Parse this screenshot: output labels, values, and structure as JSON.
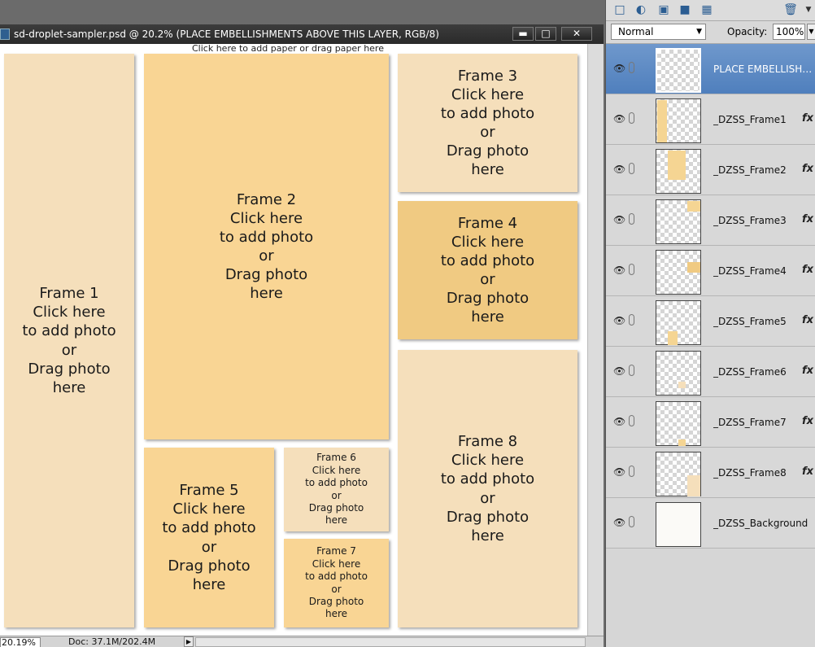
{
  "document": {
    "title": "sd-droplet-sampler.psd @ 20.2% (PLACE EMBELLISHMENTS ABOVE THIS LAYER, RGB/8)",
    "paper_hint": "Click here to add paper or drag paper here",
    "window_buttons": {
      "minimize": "▬",
      "maximize": "□",
      "close": "✕"
    },
    "frames": [
      {
        "id": "frame1",
        "label": "Frame 1\nClick here\nto add photo\nor\nDrag photo\nhere",
        "color": "#f5dfbb"
      },
      {
        "id": "frame2",
        "label": "Frame 2\nClick here\nto add photo\nor\nDrag photo\nhere",
        "color": "#f9d594"
      },
      {
        "id": "frame3",
        "label": "Frame 3\nClick here\nto add photo\nor\nDrag photo\nhere",
        "color": "#f5dfbb"
      },
      {
        "id": "frame4",
        "label": "Frame 4\nClick here\nto add photo\nor\nDrag photo\nhere",
        "color": "#f0ca82"
      },
      {
        "id": "frame5",
        "label": "Frame 5\nClick here\nto add photo\nor\nDrag photo\nhere",
        "color": "#f9d594"
      },
      {
        "id": "frame6",
        "label": "Frame 6\nClick here\nto add photo\nor\nDrag photo\nhere",
        "color": "#f5dfbb"
      },
      {
        "id": "frame7",
        "label": "Frame 7\nClick here\nto add photo\nor\nDrag photo\nhere",
        "color": "#f9d594"
      },
      {
        "id": "frame8",
        "label": "Frame 8\nClick here\nto add photo\nor\nDrag photo\nhere",
        "color": "#f5dfbb"
      }
    ]
  },
  "status": {
    "zoom": "20.19%",
    "doc_size": "Doc: 37.1M/202.4M",
    "arrow": "▶"
  },
  "panel": {
    "blend_mode": "Normal",
    "opacity_label": "Opacity:",
    "opacity_value": "100%",
    "layers": [
      {
        "name": "PLACE EMBELLISHM...",
        "selected": true,
        "fx": ""
      },
      {
        "name": "_DZSS_Frame1",
        "selected": false,
        "fx": "fx"
      },
      {
        "name": "_DZSS_Frame2",
        "selected": false,
        "fx": "fx"
      },
      {
        "name": "_DZSS_Frame3",
        "selected": false,
        "fx": "fx"
      },
      {
        "name": "_DZSS_Frame4",
        "selected": false,
        "fx": "fx"
      },
      {
        "name": "_DZSS_Frame5",
        "selected": false,
        "fx": "fx"
      },
      {
        "name": "_DZSS_Frame6",
        "selected": false,
        "fx": "fx"
      },
      {
        "name": "_DZSS_Frame7",
        "selected": false,
        "fx": "fx"
      },
      {
        "name": "_DZSS_Frame8",
        "selected": false,
        "fx": "fx"
      },
      {
        "name": "_DZSS_Background",
        "selected": false,
        "fx": ""
      }
    ]
  },
  "colors": {
    "selected_layer": "#5a87c2",
    "frame_light": "#f5dfbb",
    "frame_mid": "#f9d594",
    "frame_dark": "#f0ca82"
  }
}
